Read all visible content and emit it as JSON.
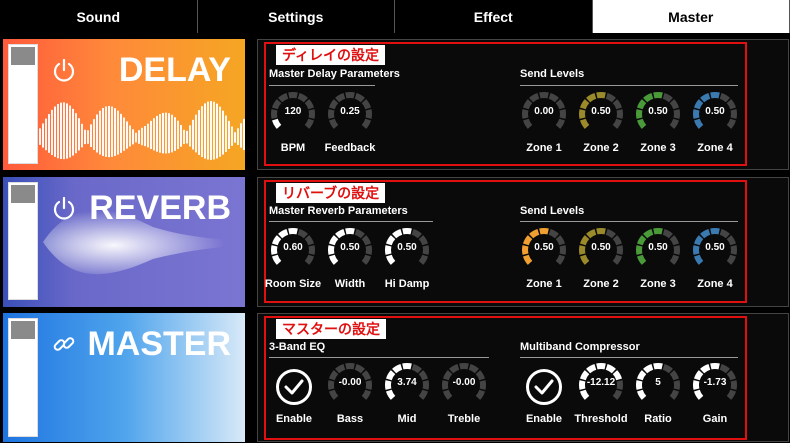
{
  "tabs": [
    {
      "label": "Sound"
    },
    {
      "label": "Settings"
    },
    {
      "label": "Effect"
    },
    {
      "label": "Master"
    }
  ],
  "colors": {
    "accent_red": "#e01010",
    "zone1_orange": "#f0a030",
    "zone2_olive": "#9a8a2a",
    "zone3_green": "#4a9a3a",
    "zone4_blue": "#3a7ab0",
    "knob_track": "#444444",
    "knob_fill": "#ffffff"
  },
  "delay": {
    "title": "DELAY",
    "icon": "power-icon",
    "tag": "ディレイの設定",
    "params_title": "Master Delay Parameters",
    "sends_title": "Send Levels",
    "knobs": [
      {
        "value": "120",
        "label": "BPM",
        "level": 0.12
      },
      {
        "value": "0.25",
        "label": "Feedback",
        "level": 0.0
      }
    ],
    "sends": [
      {
        "value": "0.00",
        "label": "Zone 1",
        "level": 0.0
      },
      {
        "value": "0.50",
        "label": "Zone 2",
        "level": 0.5
      },
      {
        "value": "0.50",
        "label": "Zone 3",
        "level": 0.5
      },
      {
        "value": "0.50",
        "label": "Zone 4",
        "level": 0.5
      }
    ]
  },
  "reverb": {
    "title": "REVERB",
    "icon": "power-icon",
    "tag": "リバーブの設定",
    "params_title": "Master Reverb Parameters",
    "sends_title": "Send Levels",
    "knobs": [
      {
        "value": "0.60",
        "label": "Room Size",
        "level": 0.6
      },
      {
        "value": "0.50",
        "label": "Width",
        "level": 0.5
      },
      {
        "value": "0.50",
        "label": "Hi Damp",
        "level": 0.5
      }
    ],
    "sends": [
      {
        "value": "0.50",
        "label": "Zone 1",
        "level": 0.5
      },
      {
        "value": "0.50",
        "label": "Zone 2",
        "level": 0.5
      },
      {
        "value": "0.50",
        "label": "Zone 3",
        "level": 0.5
      },
      {
        "value": "0.50",
        "label": "Zone 4",
        "level": 0.5
      }
    ]
  },
  "master": {
    "title": "MASTER",
    "icon": "link-icon",
    "tag": "マスターの設定",
    "eq_title": "3-Band EQ",
    "comp_title": "Multiband Compressor",
    "eq_enable_label": "Enable",
    "comp_enable_label": "Enable",
    "eq_knobs": [
      {
        "value": "-0.00",
        "label": "Bass",
        "level": 0.0
      },
      {
        "value": "3.74",
        "label": "Mid",
        "level": 0.55
      },
      {
        "value": "-0.00",
        "label": "Treble",
        "level": 0.0
      }
    ],
    "comp_knobs": [
      {
        "value": "-12.12",
        "label": "Threshold",
        "level": 0.8
      },
      {
        "value": "5",
        "label": "Ratio",
        "level": 0.6
      },
      {
        "value": "-1.73",
        "label": "Gain",
        "level": 0.55
      }
    ]
  }
}
